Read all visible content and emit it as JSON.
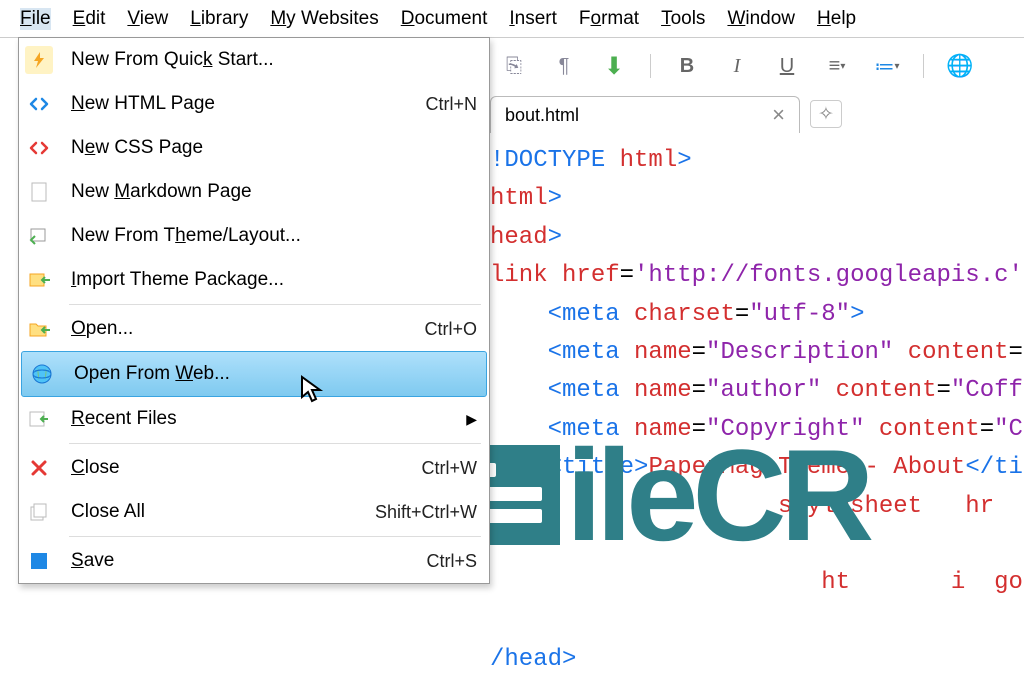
{
  "menubar": {
    "items": [
      {
        "html": "<u>F</u>ile",
        "active": true
      },
      {
        "html": "<u>E</u>dit"
      },
      {
        "html": "<u>V</u>iew"
      },
      {
        "html": "<u>L</u>ibrary"
      },
      {
        "html": "<u>M</u>y Websites"
      },
      {
        "html": "<u>D</u>ocument"
      },
      {
        "html": "<u>I</u>nsert"
      },
      {
        "html": "F<u>o</u>rmat"
      },
      {
        "html": "<u>T</u>ools"
      },
      {
        "html": "<u>W</u>indow"
      },
      {
        "html": "<u>H</u>elp"
      }
    ]
  },
  "fileMenu": [
    {
      "label": "New From Quick Start...",
      "u": 13,
      "shortcut": "",
      "ic": "lightning",
      "bg": "#fff3c4",
      "fg": "#f5a623"
    },
    {
      "label": "New HTML Page",
      "u": 0,
      "shortcut": "Ctrl+N",
      "ic": "html",
      "fg": "#1e88e5"
    },
    {
      "label": "New CSS Page",
      "u": 1,
      "shortcut": "",
      "ic": "css",
      "fg": "#e53935"
    },
    {
      "label": "New Markdown Page",
      "u": 4,
      "shortcut": "",
      "ic": "md",
      "fg": "#999"
    },
    {
      "label": "New From Theme/Layout...",
      "u": 10,
      "shortcut": "",
      "ic": "theme",
      "fg": "#4caf50"
    },
    {
      "label": "Import Theme Package...",
      "u": 0,
      "shortcut": "",
      "ic": "import",
      "fg": "#4caf50"
    },
    {
      "sep": true
    },
    {
      "label": "Open...",
      "u": 0,
      "shortcut": "Ctrl+O",
      "ic": "open",
      "fg": "#4caf50"
    },
    {
      "label": "Open From Web...",
      "u": 10,
      "shortcut": "",
      "ic": "web",
      "fg": "#4caf50",
      "hl": true
    },
    {
      "label": "Recent Files",
      "u": 0,
      "shortcut": "",
      "submenu": true,
      "ic": "recent",
      "fg": "#4caf50"
    },
    {
      "sep": true
    },
    {
      "label": "Close",
      "u": 0,
      "shortcut": "Ctrl+W",
      "ic": "close",
      "fg": "#e53935"
    },
    {
      "label": "Close All",
      "u": -1,
      "shortcut": "Shift+Ctrl+W",
      "ic": "closeall",
      "fg": "#aaa"
    },
    {
      "sep": true
    },
    {
      "label": "Save",
      "u": 0,
      "shortcut": "Ctrl+S",
      "ic": "save",
      "fg": "#4caf50"
    }
  ],
  "tab": {
    "name": "bout.html",
    "close": "×"
  },
  "code": [
    "!DOCTYPE html>",
    "html>",
    "head>",
    "link href='http://fonts.googleapis.c",
    "    <meta charset=\"utf-8\">",
    "    <meta name=\"Description\" content=",
    "    <meta name=\"author\" content=\"Coff",
    "    <meta name=\"Copyright\" content=\"C",
    "    <title>PaperMag Theme - About</ti",
    "                    stylesheet   hr         tyl",
    "",
    "                       ht       i  goo",
    "",
    "/head>"
  ],
  "watermark": "ileCR"
}
